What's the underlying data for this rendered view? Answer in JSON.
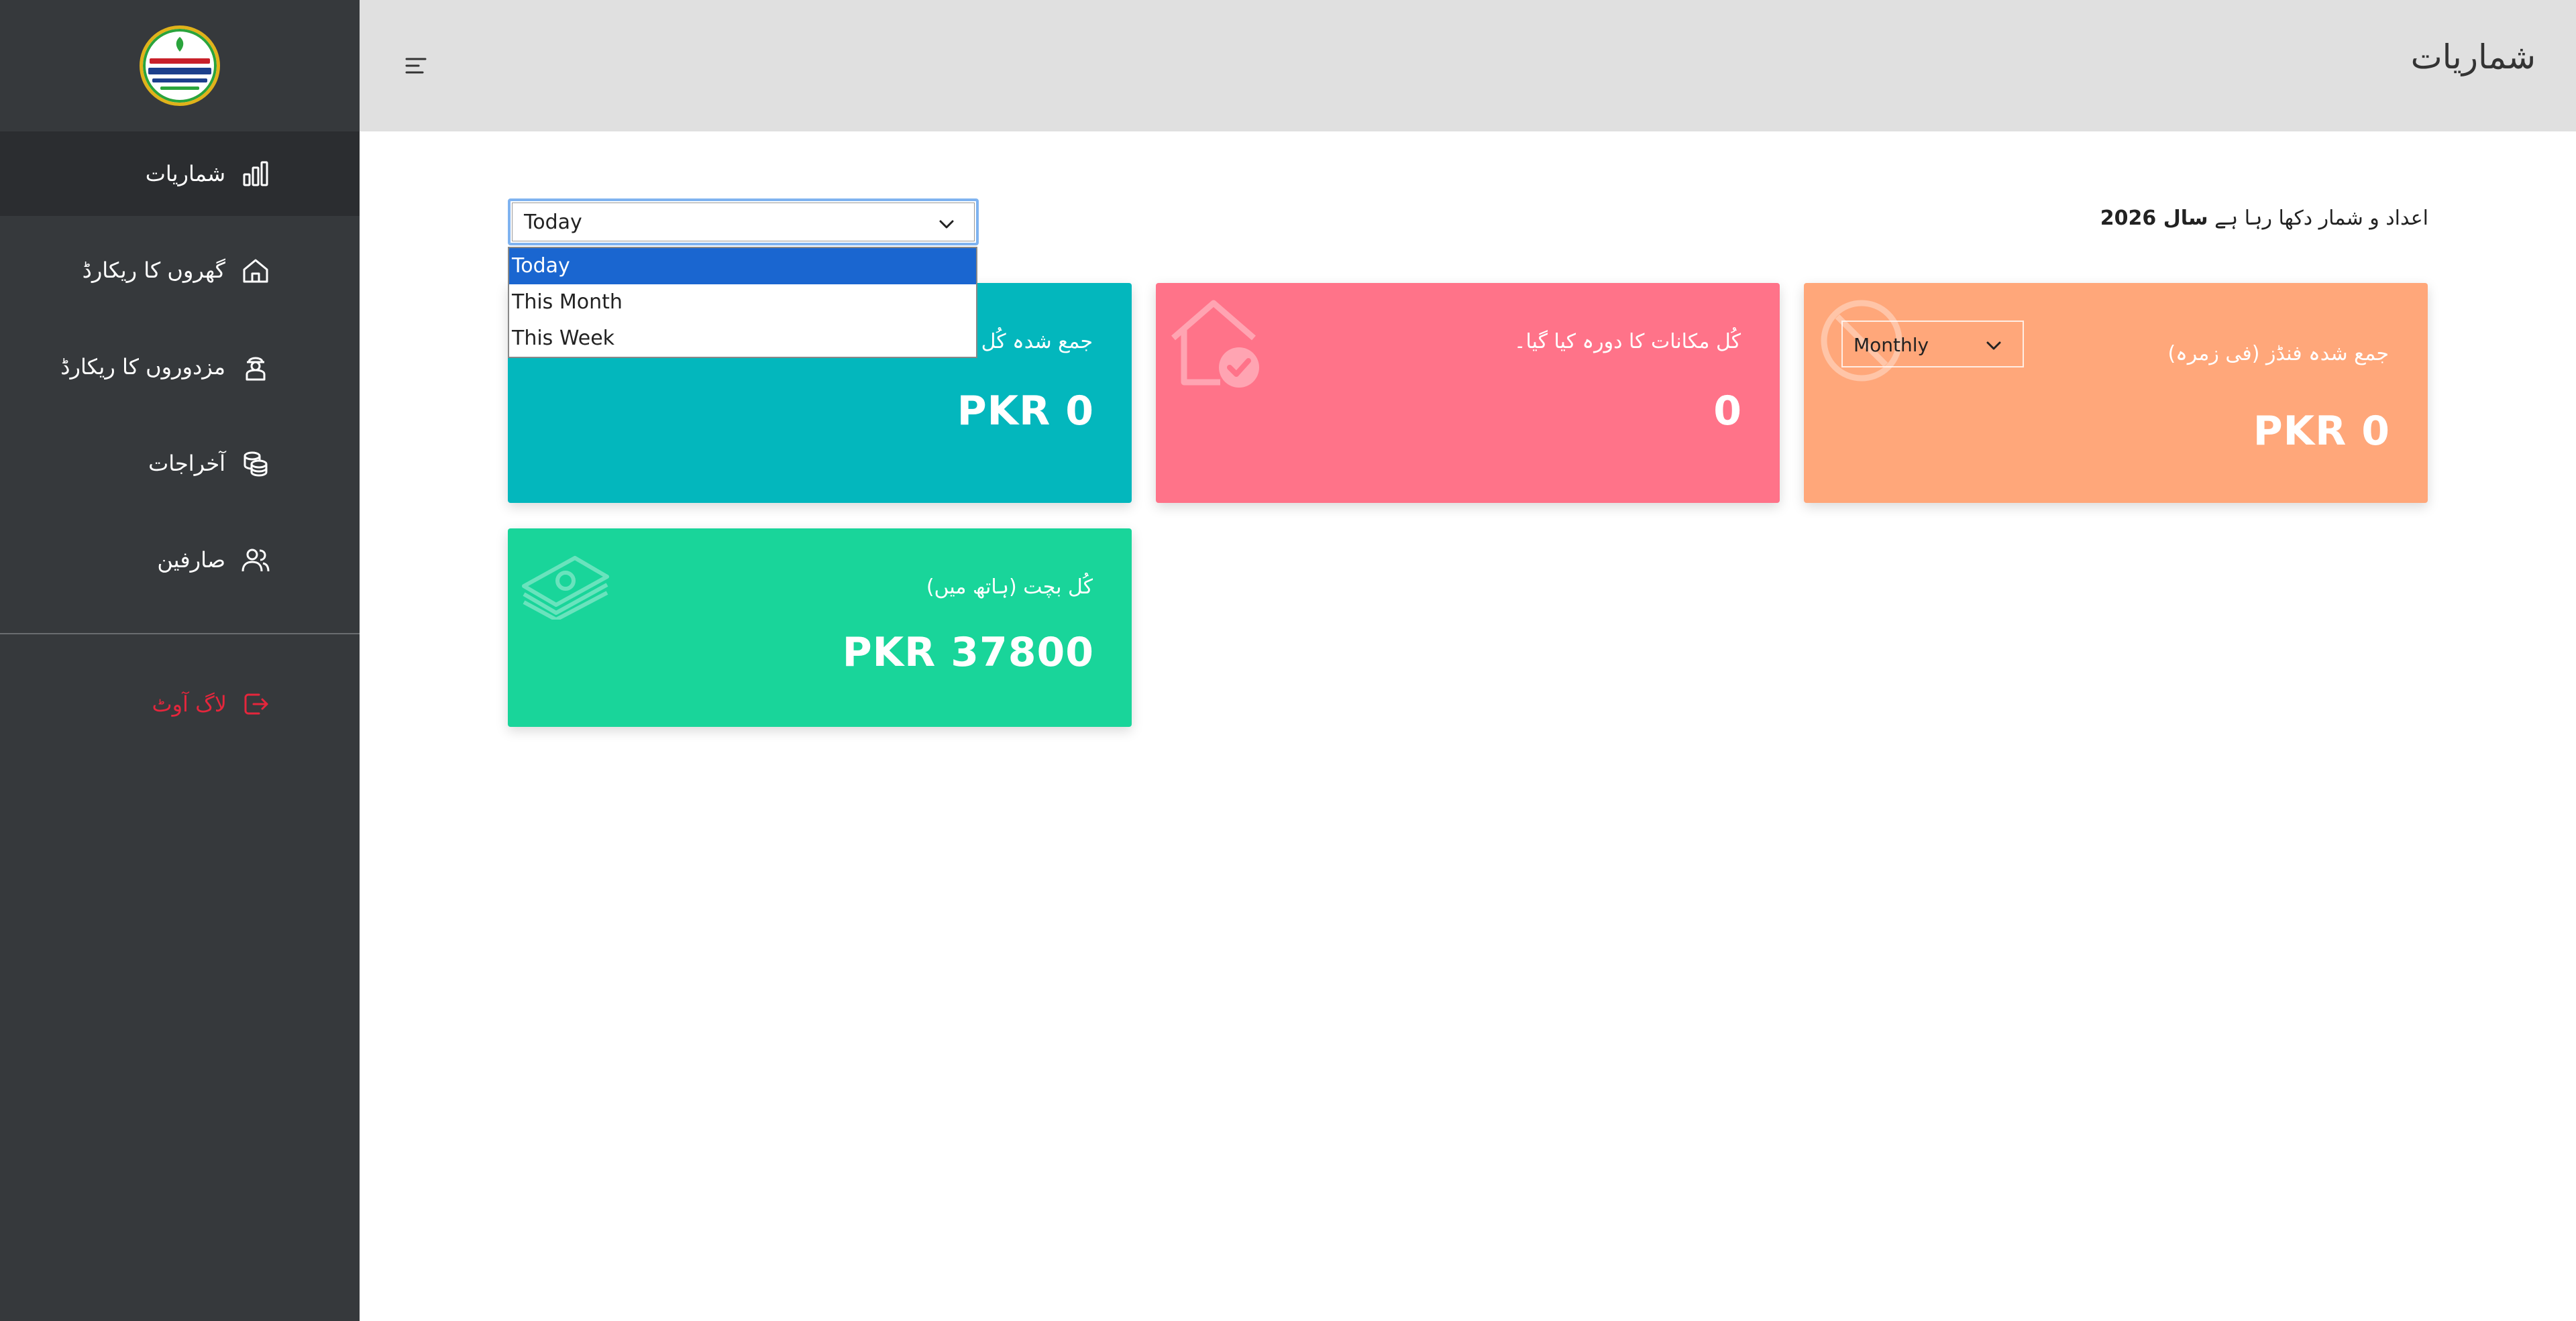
{
  "sidebar": {
    "items": [
      {
        "label": "شماریات",
        "icon": "bar-chart-icon",
        "active": true
      },
      {
        "label": "گھروں کا ریکارڈ",
        "icon": "house-icon"
      },
      {
        "label": "مزدوروں کا ریکارڈ",
        "icon": "worker-icon"
      },
      {
        "label": "آخراجات",
        "icon": "coins-icon"
      },
      {
        "label": "صارفین",
        "icon": "users-icon"
      }
    ],
    "logout": {
      "label": "لاگ آوٹ",
      "icon": "logout-icon",
      "color": "#e5263c"
    }
  },
  "header": {
    "title": "شماریات"
  },
  "filter": {
    "selected": "Today",
    "options": [
      "Today",
      "This Month",
      "This Week"
    ]
  },
  "intro": {
    "prefix": "اعداد و شمار دکھا رہا ہے",
    "year_label": "سال 2026"
  },
  "cards": {
    "collected_total": {
      "title": "جمع شدہ کُل فنڈز",
      "value": "PKR 0",
      "icon": "circle-icon",
      "color": "#03b7bd"
    },
    "houses_visited": {
      "title": "کُل مکانات کا دورہ کیا گیا۔",
      "value": "0",
      "icon": "house-check-icon",
      "color": "#ff7389"
    },
    "collected_per_category": {
      "title": "جمع شدہ فنڈز (فی زمرہ)",
      "value": "PKR 0",
      "select_value": "Monthly",
      "icon": "circle-icon",
      "color": "#ffa77a"
    },
    "total_savings": {
      "title": "کُل بچت (ہاتھ میں)",
      "value": "PKR 37800",
      "icon": "money-stack-icon",
      "color": "#19d59a"
    }
  }
}
